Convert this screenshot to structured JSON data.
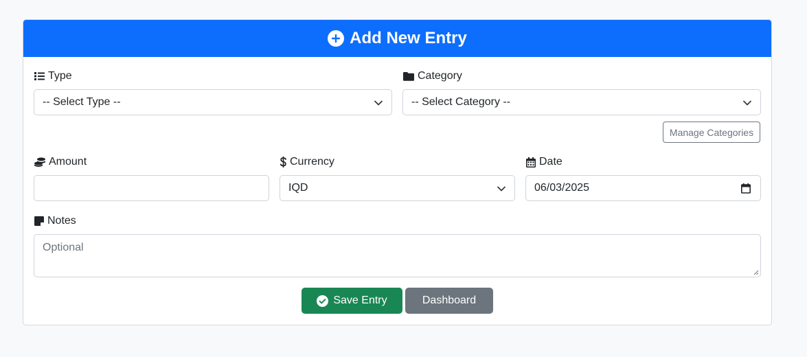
{
  "header": {
    "title": "Add New Entry",
    "icon": "plus-circle-icon",
    "color": "#0d6efd"
  },
  "form": {
    "type": {
      "label": "Type",
      "icon": "list-icon",
      "value": "-- Select Type --"
    },
    "category": {
      "label": "Category",
      "icon": "folder-icon",
      "value": "-- Select Category --"
    },
    "manage_categories_label": "Manage Categories",
    "amount": {
      "label": "Amount",
      "icon": "coins-icon",
      "value": ""
    },
    "currency": {
      "label": "Currency",
      "icon": "dollar-icon",
      "value": "IQD"
    },
    "date": {
      "label": "Date",
      "icon": "calendar-icon",
      "value": "06/03/2025"
    },
    "notes": {
      "label": "Notes",
      "icon": "note-icon",
      "placeholder": "Optional"
    }
  },
  "actions": {
    "save_label": "Save Entry",
    "save_color": "#198754",
    "dashboard_label": "Dashboard",
    "dashboard_color": "#6c757d"
  }
}
